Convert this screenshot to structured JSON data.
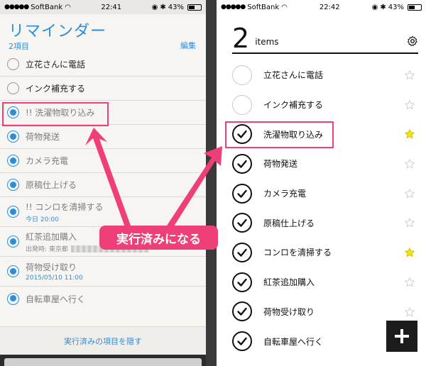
{
  "left": {
    "statusbar": {
      "carrier": "SoftBank",
      "time": "22:41",
      "battery": "43%"
    },
    "title": "リマインダー",
    "count": "2項目",
    "edit": "編集",
    "items": [
      {
        "text": "立花さんに電話",
        "done": false,
        "sub": ""
      },
      {
        "text": "インク補充する",
        "done": false,
        "sub": ""
      },
      {
        "text": "!! 洗濯物取り込み",
        "done": true,
        "sub": ""
      },
      {
        "text": "荷物発送",
        "done": true,
        "sub": ""
      },
      {
        "text": "カメラ充電",
        "done": true,
        "sub": ""
      },
      {
        "text": "原稿仕上げる",
        "done": true,
        "sub": ""
      },
      {
        "text": "!! コンロを清掃する",
        "done": true,
        "sub": "今日 20:00"
      },
      {
        "text": "紅茶追加購入",
        "done": true,
        "sub": "出発時: 東京都"
      },
      {
        "text": "荷物受け取り",
        "done": true,
        "sub": "2015/05/10 11:00"
      },
      {
        "text": "自転車屋へ行く",
        "done": true,
        "sub": ""
      }
    ],
    "hide_completed": "実行済みの項目を隠す"
  },
  "right": {
    "statusbar": {
      "carrier": "SoftBank",
      "time": "22:42",
      "battery": "43%"
    },
    "count_number": "2",
    "count_label": "items",
    "items": [
      {
        "text": "立花さんに電話",
        "done": false,
        "starred": false
      },
      {
        "text": "インク補充する",
        "done": false,
        "starred": false
      },
      {
        "text": "洗濯物取り込み",
        "done": true,
        "starred": true
      },
      {
        "text": "荷物発送",
        "done": true,
        "starred": false
      },
      {
        "text": "カメラ充電",
        "done": true,
        "starred": false
      },
      {
        "text": "原稿仕上げる",
        "done": true,
        "starred": false
      },
      {
        "text": "コンロを清掃する",
        "done": true,
        "starred": true
      },
      {
        "text": "紅茶追加購入",
        "done": true,
        "starred": false
      },
      {
        "text": "荷物受け取り",
        "done": true,
        "starred": false
      },
      {
        "text": "自転車屋へ行く",
        "done": true,
        "starred": false
      }
    ],
    "icons": {
      "settings": "gear-icon",
      "add": "plus-icon",
      "star": "star-icon"
    }
  },
  "annotation": {
    "callout": "実行済みになる",
    "colors": {
      "accent": "#ee3f78",
      "ios_blue": "#2e8dd8",
      "star": "#f2e600"
    }
  }
}
